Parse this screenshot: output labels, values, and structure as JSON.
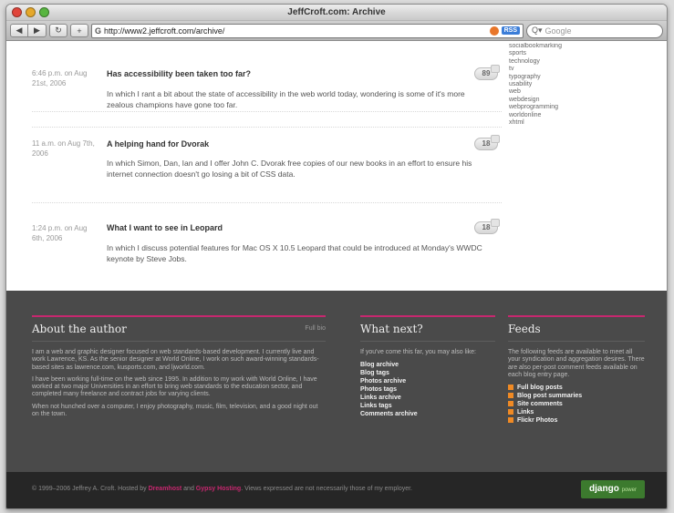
{
  "window": {
    "title": "JeffCroft.com: Archive",
    "traffic_lights": [
      "#e0453b",
      "#e5a82b",
      "#58b540"
    ]
  },
  "toolbar": {
    "back_icon": "back-icon",
    "forward_icon": "forward-icon",
    "reload_icon": "reload-icon",
    "add_icon": "add-bookmark-icon",
    "address": "http://www2.jeffcroft.com/archive/",
    "rss_label": "RSS",
    "search_placeholder": "Google"
  },
  "posts": [
    {
      "date": "6:46 p.m. on Aug 21st, 2006",
      "title": "Has accessibility been taken too far?",
      "comments": "89",
      "description": "In which I rant a bit about the state of accessibility in the web world today, wondering is some of it's more zealous champions have gone too far."
    },
    {
      "date": "11 a.m. on Aug 7th, 2006",
      "title": "A helping hand for Dvorak",
      "comments": "18",
      "description": "In which Simon, Dan, Ian and I offer John C. Dvorak free copies of our new books in an effort to ensure his internet connection doesn't go losing a bit of CSS data."
    },
    {
      "date": "1:24 p.m. on Aug 6th, 2006",
      "title": "What I want to see in Leopard",
      "comments": "18",
      "description": "In which I discuss potential features for Mac OS X 10.5 Leopard that could be introduced at Monday's WWDC keynote by Steve Jobs."
    }
  ],
  "tags": [
    "socialbookmarking",
    "sports",
    "technology",
    "tv",
    "typography",
    "usability",
    "web",
    "webdesign",
    "webprogramming",
    "worldonline",
    "xhtml"
  ],
  "footer": {
    "accent": "#c7276f",
    "about": {
      "heading": "About the author",
      "more": "Full bio",
      "paragraphs": [
        "I am a web and graphic designer focused on web standards-based development. I currently live and work Lawrence, KS. As the senior designer at World Online, I work on such award-winning standards-based sites as lawrence.com, kusports.com, and ljworld.com.",
        "I have been working full-time on the web since 1995. In addition to my work with World Online, I have worked at two major Universities in an effort to bring web standards to the education sector, and completed many freelance and contract jobs for varying clients.",
        "When not hunched over a computer, I enjoy photography, music, film, television, and a good night out on the town."
      ]
    },
    "next": {
      "heading": "What next?",
      "intro": "If you've come this far, you may also like:",
      "links": [
        "Blog archive",
        "Blog tags",
        "Photos archive",
        "Photos tags",
        "Links archive",
        "Links tags",
        "Comments archive"
      ]
    },
    "feeds": {
      "heading": "Feeds",
      "intro": "The following feeds are available to meet all your syndication and aggregation desires. There are also per-post comment feeds available on each blog entry page.",
      "links": [
        "Full blog posts",
        "Blog post summaries",
        "Site comments",
        "Links",
        "Flickr Photos"
      ]
    },
    "copyright_prefix": "© 1999–2006 Jeffrey A. Croft. Hosted by",
    "host1": "Dreamhost",
    "and": "and",
    "host2": "Gypsy Hosting",
    "copyright_suffix": ". Views expressed are not necessarily those of my employer.",
    "django_badge": "django",
    "django_sub": "power"
  }
}
